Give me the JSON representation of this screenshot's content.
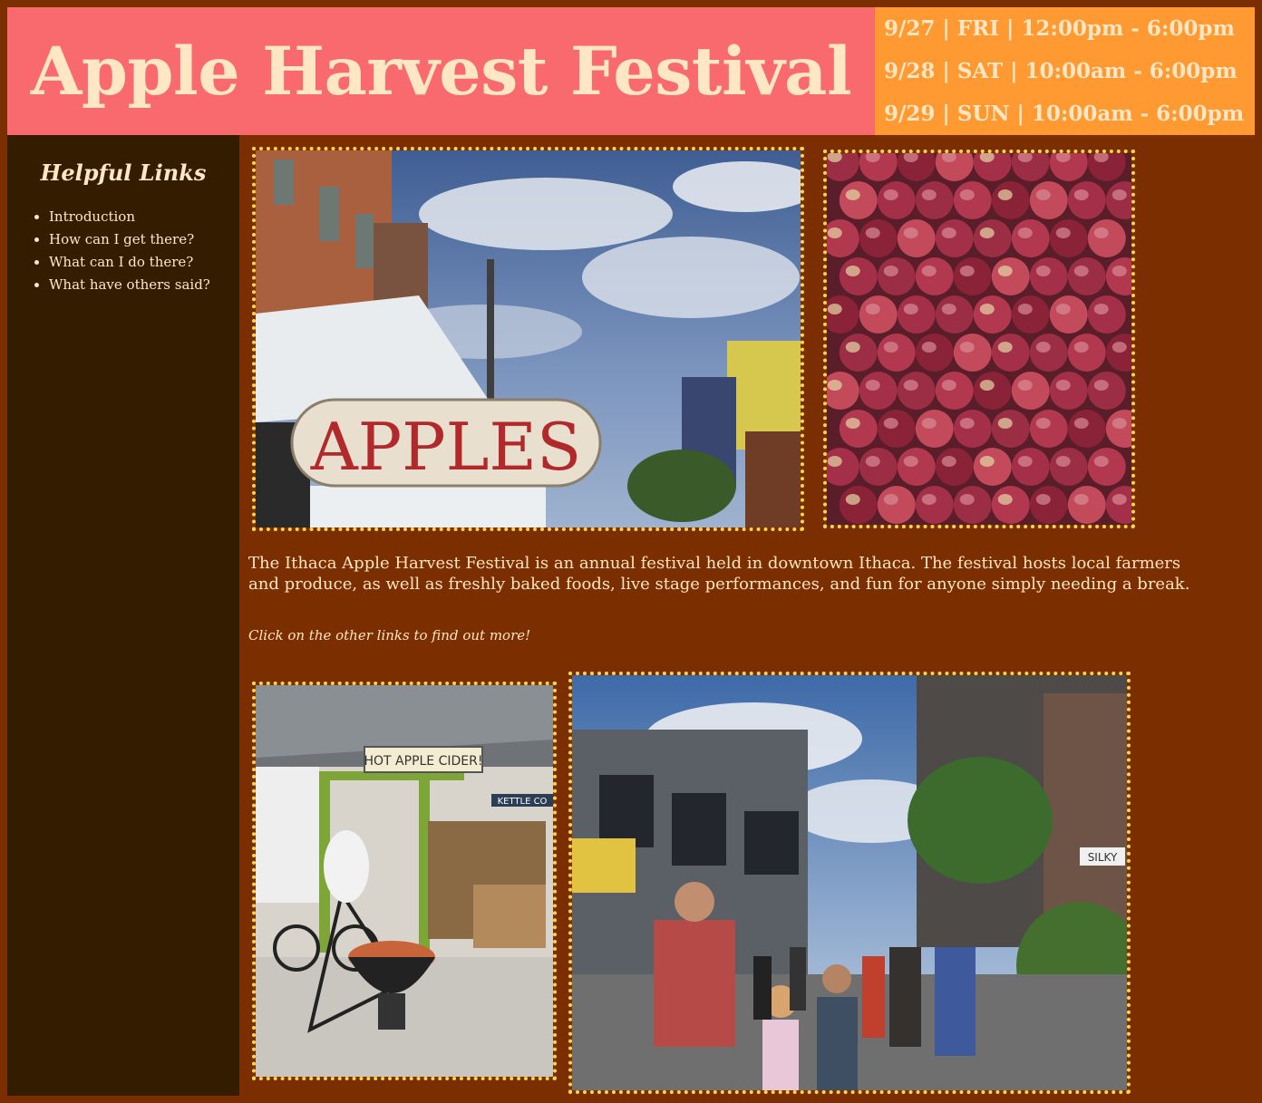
{
  "header": {
    "title": "Apple Harvest Festival",
    "dates": [
      "9/27 | FRI | 12:00pm - 6:00pm",
      "9/28 | SAT | 10:00am - 6:00pm",
      "9/29 | SUN | 10:00am - 6:00pm"
    ]
  },
  "sidebar": {
    "heading": "Helpful Links",
    "links": [
      {
        "label": "Introduction"
      },
      {
        "label": "How can I get there?"
      },
      {
        "label": "What can I do there?"
      },
      {
        "label": "What have others said?"
      }
    ]
  },
  "main": {
    "photos": {
      "apples_sign_text": "APPLES",
      "cider_sign_text": "HOT APPLE CIDER!",
      "kettle_text": "KETTLE CO",
      "silky_text": "SILKY"
    },
    "intro": "The Ithaca Apple Harvest Festival is an annual festival held in downtown Ithaca. The festival hosts local farmers and produce, as well as freshly baked foods, live stage performances, and fun for anyone simply needing a break.",
    "cta": "Click on the other links to find out more!"
  },
  "colors": {
    "title_bg": "#f86a6e",
    "dates_bg": "#ff9a33",
    "page_bg": "#7b2e00",
    "sidebar_bg": "#331c00",
    "text": "#ffe6c4",
    "photo_border": "#ffd84d"
  }
}
